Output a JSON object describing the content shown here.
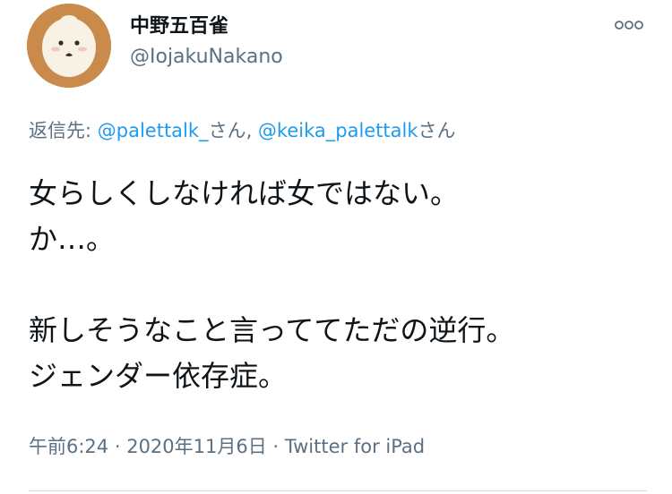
{
  "user": {
    "display_name": "中野五百雀",
    "handle": "@IojakuNakano",
    "avatar_icon": "cartoon-face-avatar",
    "avatar_color": "#c98a4b"
  },
  "more_icon": "more-options-icon",
  "reply": {
    "prefix": "返信先: ",
    "mentions": [
      {
        "handle": "@palettalk_",
        "suffix": "さん"
      },
      {
        "handle": "@keika_palettalk",
        "suffix": "さん"
      }
    ],
    "separator": ", "
  },
  "body": {
    "lines": [
      "女らしくしなければ女ではない。",
      "か…。",
      "",
      "新しそうなこと言っててただの逆行。",
      "ジェンダー依存症。"
    ]
  },
  "meta": {
    "time": "午前6:24",
    "dot1": " · ",
    "date": "2020年11月6日",
    "dot2": " · ",
    "source": "Twitter for iPad"
  },
  "colors": {
    "link": "#1d9bf0",
    "secondary_text": "#5b7083",
    "primary_text": "#0f1419"
  }
}
